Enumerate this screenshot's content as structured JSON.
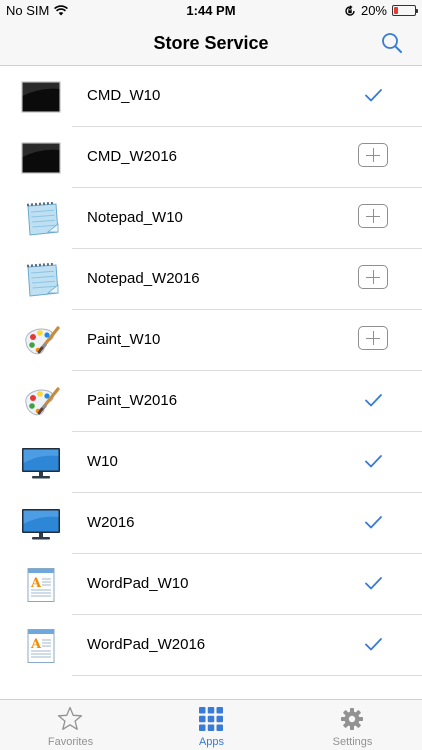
{
  "status_bar": {
    "carrier": "No SIM",
    "time": "1:44 PM",
    "battery": "20%",
    "battery_level": 0.2
  },
  "nav": {
    "title": "Store Service"
  },
  "items": [
    {
      "label": "CMD_W10",
      "icon": "cmd-icon",
      "state": "installed"
    },
    {
      "label": "CMD_W2016",
      "icon": "cmd-icon",
      "state": "add"
    },
    {
      "label": "Notepad_W10",
      "icon": "notepad-icon",
      "state": "add"
    },
    {
      "label": "Notepad_W2016",
      "icon": "notepad-icon",
      "state": "add"
    },
    {
      "label": "Paint_W10",
      "icon": "paint-icon",
      "state": "add"
    },
    {
      "label": "Paint_W2016",
      "icon": "paint-icon",
      "state": "installed"
    },
    {
      "label": "W10",
      "icon": "monitor-icon",
      "state": "installed"
    },
    {
      "label": "W2016",
      "icon": "monitor-icon",
      "state": "installed"
    },
    {
      "label": "WordPad_W10",
      "icon": "wordpad-icon",
      "state": "installed"
    },
    {
      "label": "WordPad_W2016",
      "icon": "wordpad-icon",
      "state": "installed"
    }
  ],
  "tabs": [
    {
      "label": "Favorites",
      "icon": "star-icon",
      "active": false
    },
    {
      "label": "Apps",
      "icon": "grid-icon",
      "active": true
    },
    {
      "label": "Settings",
      "icon": "gear-icon",
      "active": false
    }
  ],
  "colors": {
    "accent": "#3a7bd5",
    "inactive": "#929292",
    "battery_low": "#e53935"
  }
}
